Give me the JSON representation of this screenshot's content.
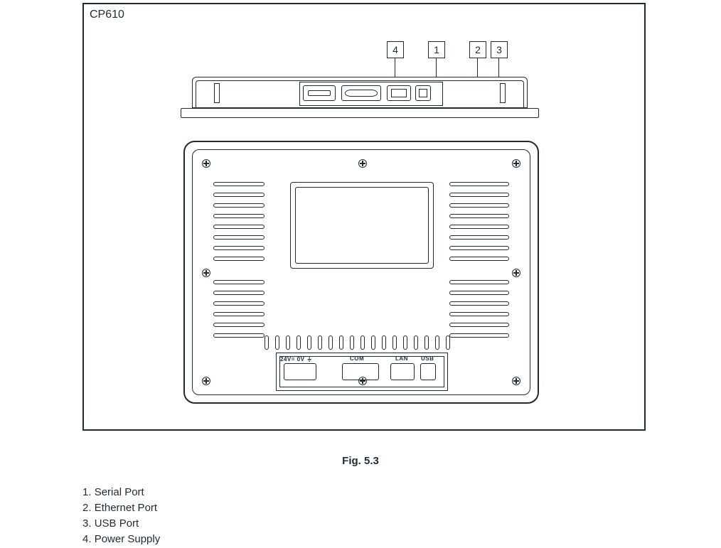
{
  "model": "CP610",
  "callouts": {
    "power": {
      "number": "4"
    },
    "serial": {
      "number": "1"
    },
    "ethernet": {
      "number": "2"
    },
    "usb": {
      "number": "3"
    }
  },
  "rear_labels": {
    "power": "24V= 0V ⏚",
    "com": "COM",
    "lan": "LAN",
    "usb": "USB"
  },
  "figure_caption": "Fig. 5.3",
  "legend": [
    {
      "n": "1",
      "text": "Serial Port"
    },
    {
      "n": "2",
      "text": "Ethernet Port"
    },
    {
      "n": "3",
      "text": "USB Port"
    },
    {
      "n": "4",
      "text": "Power Supply"
    }
  ]
}
